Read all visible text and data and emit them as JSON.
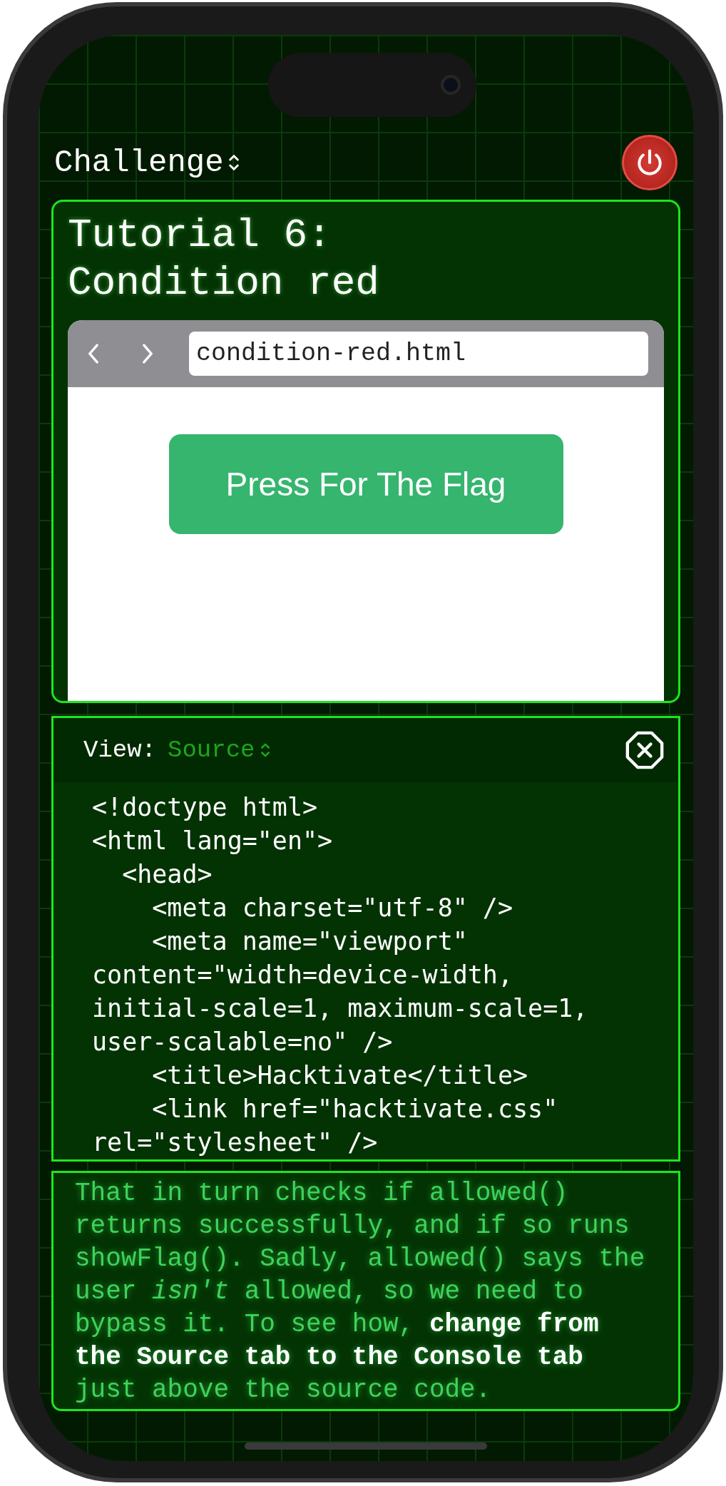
{
  "header": {
    "selector": "Challenge"
  },
  "tutorial": {
    "title": "Tutorial 6:\nCondition red",
    "browser": {
      "url": "condition-red.html",
      "button": "Press For The Flag"
    }
  },
  "source_view": {
    "label": "View:",
    "value": "Source",
    "lines": [
      "<!doctype html>",
      "<html lang=\"en\">",
      "  <head>",
      "    <meta charset=\"utf-8\" />",
      "    <meta name=\"viewport\"",
      "content=\"width=device-width,",
      "initial-scale=1, maximum-scale=1,",
      "user-scalable=no\" />",
      "    <title>Hacktivate</title>",
      "    <link href=\"hacktivate.css\"",
      "rel=\"stylesheet\" />"
    ]
  },
  "hint": "That in turn checks if allowed() returns successfully, and if so runs showFlag(). Sadly, allowed() says the user *isn't* allowed, so we need to bypass it. To see how, **change from the Source tab to the Console tab** just above the source code."
}
